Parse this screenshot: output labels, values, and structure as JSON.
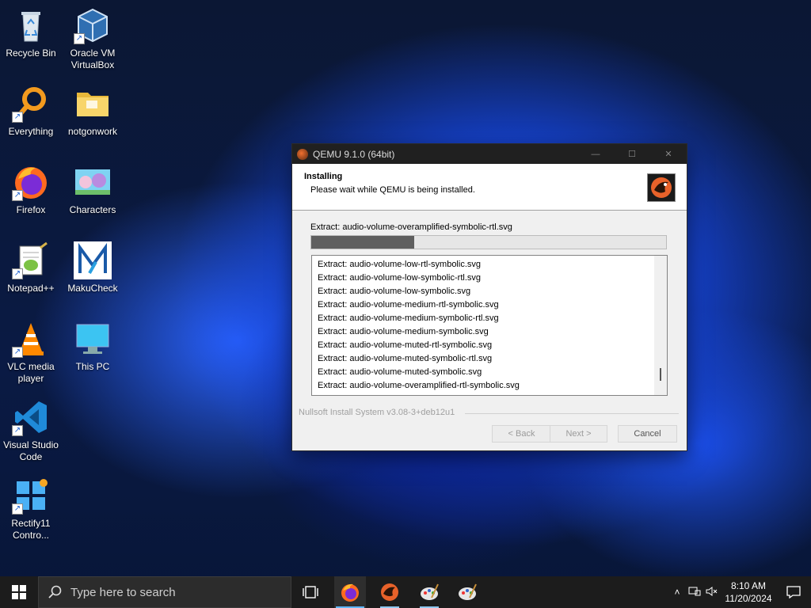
{
  "desktop_icons": [
    {
      "label": "Recycle Bin",
      "icon": "recycle-bin-icon"
    },
    {
      "label": "Oracle VM\nVirtualBox",
      "icon": "virtualbox-icon"
    },
    {
      "label": "Everything",
      "icon": "everything-search-icon"
    },
    {
      "label": "notgonwork",
      "icon": "folder-icon"
    },
    {
      "label": "Firefox",
      "icon": "firefox-icon"
    },
    {
      "label": "Characters",
      "icon": "characters-image-icon"
    },
    {
      "label": "Notepad++",
      "icon": "notepadpp-icon"
    },
    {
      "label": "MakuCheck",
      "icon": "makucheck-icon"
    },
    {
      "label": "VLC media\nplayer",
      "icon": "vlc-icon"
    },
    {
      "label": "This PC",
      "icon": "this-pc-icon"
    },
    {
      "label": "Visual Studio\nCode",
      "icon": "vscode-icon"
    },
    {
      "label": "Rectify11\nContro...",
      "icon": "rectify11-icon"
    }
  ],
  "installer": {
    "title": "QEMU 9.1.0 (64bit)",
    "header_title": "Installing",
    "header_subtitle": "Please wait while QEMU is being installed.",
    "current_status": "Extract: audio-volume-overamplified-symbolic-rtl.svg",
    "progress_fraction": 0.29,
    "log": [
      "Extract: audio-volume-low-rtl-symbolic.svg",
      "Extract: audio-volume-low-symbolic-rtl.svg",
      "Extract: audio-volume-low-symbolic.svg",
      "Extract: audio-volume-medium-rtl-symbolic.svg",
      "Extract: audio-volume-medium-symbolic-rtl.svg",
      "Extract: audio-volume-medium-symbolic.svg",
      "Extract: audio-volume-muted-rtl-symbolic.svg",
      "Extract: audio-volume-muted-symbolic-rtl.svg",
      "Extract: audio-volume-muted-symbolic.svg",
      "Extract: audio-volume-overamplified-rtl-symbolic.svg"
    ],
    "branding": "Nullsoft Install System v3.08-3+deb12u1",
    "back_label": "< Back",
    "next_label": "Next >",
    "cancel_label": "Cancel"
  },
  "taskbar": {
    "search_placeholder": "Type here to search",
    "apps": [
      "task-view-icon",
      "firefox-icon",
      "qemu-icon",
      "paint-icon",
      "paint-icon"
    ],
    "time": "8:10 AM",
    "date": "11/20/2024"
  },
  "colors": {
    "accent": "#5fb7ff",
    "progress_fill": "#5f5f5f",
    "titlebar": "#202020"
  }
}
